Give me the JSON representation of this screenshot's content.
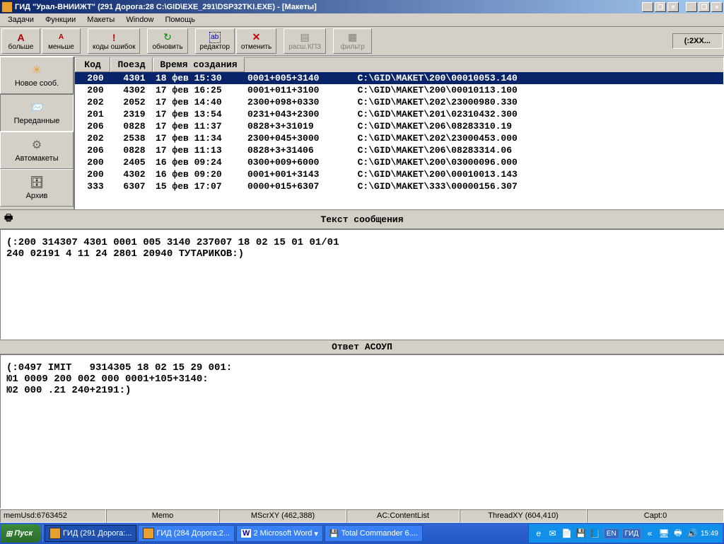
{
  "window": {
    "title": "ГИД \"Урал-ВНИИЖТ\" (291 Дорога:28 C:\\GID\\EXE_291\\DSP32TKI.EXE) - [Макеты]"
  },
  "menu": {
    "items": [
      "Задачи",
      "Функции",
      "Макеты",
      "Window",
      "Помощь"
    ]
  },
  "toolbar": {
    "more": "больше",
    "less": "меньше",
    "errors": "коды ошибок",
    "refresh": "обновить",
    "editor": "редактор",
    "cancel": "отменить",
    "rasp": "расш.КПЗ",
    "filter": "фильтр",
    "code": "(:2XX..."
  },
  "sidebar": {
    "items": [
      {
        "label": "Новое сооб."
      },
      {
        "label": "Переданные"
      },
      {
        "label": "Автомакеты"
      },
      {
        "label": "Архив"
      }
    ]
  },
  "table": {
    "headers": {
      "code": "Код",
      "train": "Поезд",
      "created": "Время создания"
    },
    "rows": [
      {
        "code": "200",
        "train": "4301",
        "time": "18 фев 15:30",
        "idx": "0001+005+3140",
        "path": "C:\\GID\\MAKET\\200\\00010053.140",
        "sel": true
      },
      {
        "code": "200",
        "train": "4302",
        "time": "17 фев 16:25",
        "idx": "0001+011+3100",
        "path": "C:\\GID\\MAKET\\200\\00010113.100"
      },
      {
        "code": "202",
        "train": "2052",
        "time": "17 фев 14:40",
        "idx": "2300+098+0330",
        "path": "C:\\GID\\MAKET\\202\\23000980.330"
      },
      {
        "code": "201",
        "train": "2319",
        "time": "17 фев 13:54",
        "idx": "0231+043+2300",
        "path": "C:\\GID\\MAKET\\201\\02310432.300"
      },
      {
        "code": "206",
        "train": "0828",
        "time": "17 фев 11:37",
        "idx": "0828+3+31019",
        "path": "C:\\GID\\MAKET\\206\\08283310.19"
      },
      {
        "code": "202",
        "train": "2538",
        "time": "17 фев 11:34",
        "idx": "2300+045+3000",
        "path": "C:\\GID\\MAKET\\202\\23000453.000"
      },
      {
        "code": "206",
        "train": "0828",
        "time": "17 фев 11:13",
        "idx": "0828+3+31406",
        "path": "C:\\GID\\MAKET\\206\\08283314.06"
      },
      {
        "code": "200",
        "train": "2405",
        "time": "16 фев 09:24",
        "idx": "0300+009+6000",
        "path": "C:\\GID\\MAKET\\200\\03000096.000"
      },
      {
        "code": "200",
        "train": "4302",
        "time": "16 фев 09:20",
        "idx": "0001+001+3143",
        "path": "C:\\GID\\MAKET\\200\\00010013.143"
      },
      {
        "code": "333",
        "train": "6307",
        "time": "15 фев 17:07",
        "idx": "0000+015+6307",
        "path": "C:\\GID\\MAKET\\333\\00000156.307"
      }
    ]
  },
  "msg": {
    "title": "Текст сообщения",
    "body": "(:200 314307 4301 0001 005 3140 237007 18 02 15 01 01/01\n240 02191 4 11 24 2801 20940 ТУТАРИКОВ:)"
  },
  "reply": {
    "title": "Ответ АСОУП",
    "body": "(:0497 IMIT   9314305 18 02 15 29 001:\nЮ1 0009 200 002 000 0001+105+3140:\nЮ2 000 .21 240+2191:)"
  },
  "status": {
    "mem": "memUsd:6763452",
    "memo": "Memo",
    "mscr": "MScrXY (462,388)",
    "ac": "AC:ContentList",
    "thread": "ThreadXY (604,410)",
    "capt": "Capt:0"
  },
  "taskbar": {
    "start": "Пуск",
    "tasks": [
      {
        "label": "ГИД (291 Дорога:...",
        "active": true
      },
      {
        "label": "ГИД (284 Дорога:2..."
      },
      {
        "label": "2 Microsoft Word"
      },
      {
        "label": "Total Commander 6...."
      }
    ],
    "gid": "ГИД",
    "lang": "EN",
    "time": "15:49"
  }
}
